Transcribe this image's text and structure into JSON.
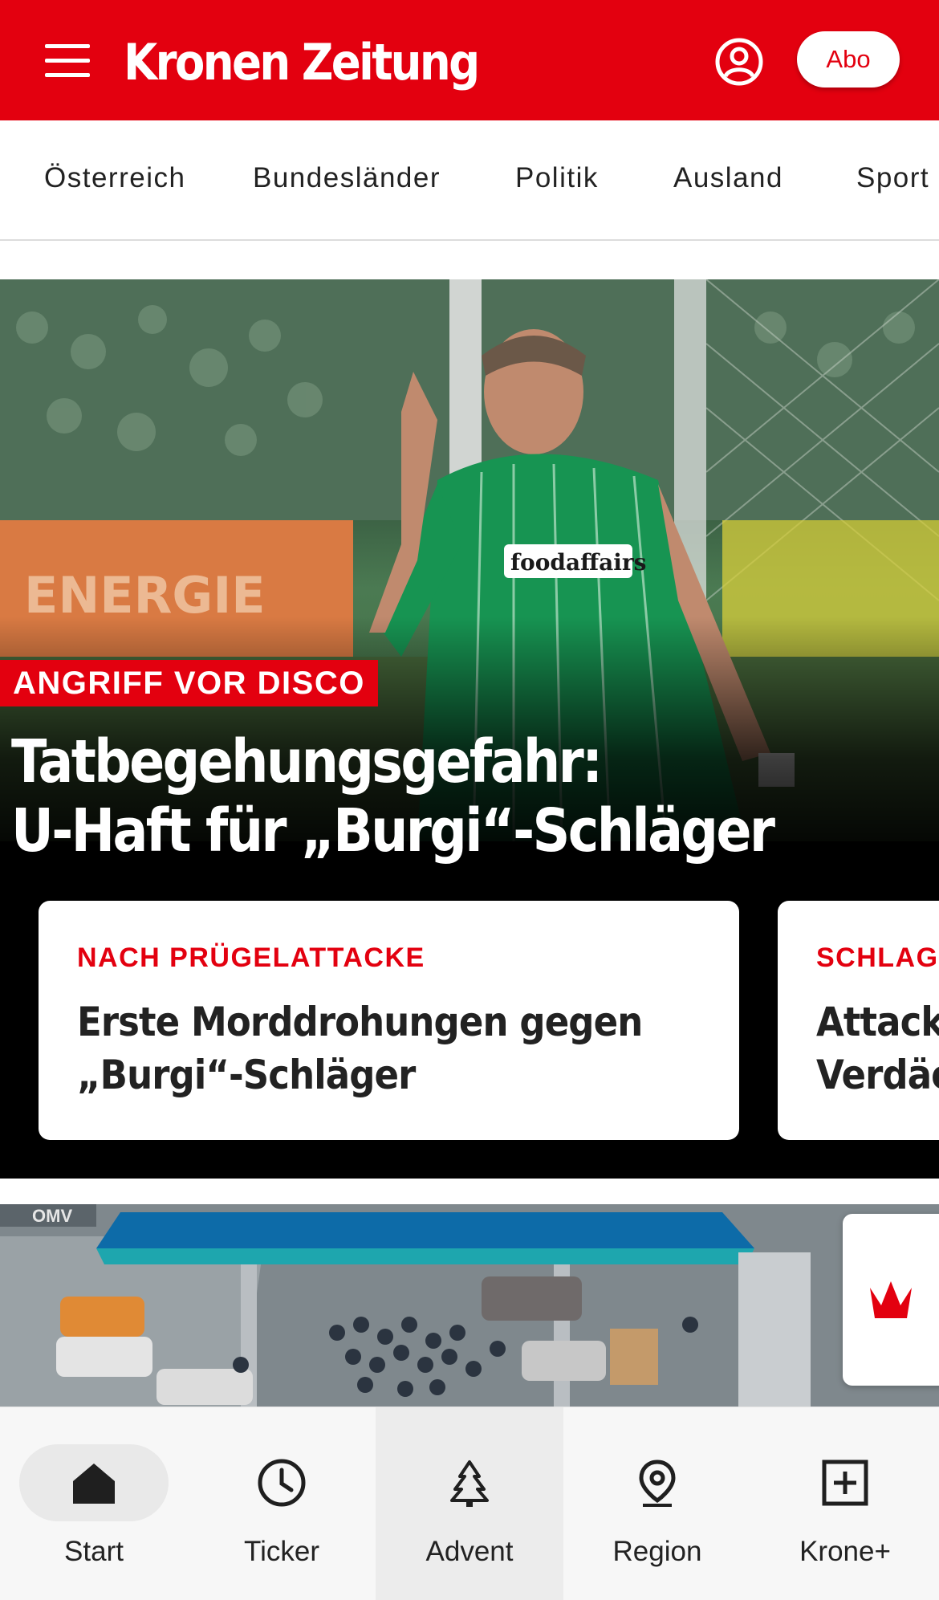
{
  "header": {
    "menu_icon": "hamburger-menu-icon",
    "logo": "Kronen Zeitung",
    "user_icon": "user-account-icon",
    "abo_label": "Abo",
    "brand_color": "#e3000f"
  },
  "nav": {
    "items": [
      "Österreich",
      "Bundesländer",
      "Politik",
      "Ausland",
      "Sport"
    ]
  },
  "hero": {
    "kicker": "ANGRIFF VOR DISCO",
    "title_line1": "Tatbegehungsgefahr:",
    "title_line2": "U-Haft für „Burgi“-Schläger",
    "teasers": [
      {
        "kicker": "NACH PRÜGELATTACKE",
        "title_line1": "Erste Morddrohungen gegen",
        "title_line2": "„Burgi“-Schläger"
      },
      {
        "kicker": "SCHLAG",
        "title_line1": "Attack",
        "title_line2": "Verdäc"
      }
    ]
  },
  "krone_plus_floating": {
    "icon": "krone-crown-icon"
  },
  "bottom_nav": {
    "items": [
      {
        "label": "Start",
        "icon": "home-icon"
      },
      {
        "label": "Ticker",
        "icon": "clock-icon"
      },
      {
        "label": "Advent",
        "icon": "christmas-tree-icon"
      },
      {
        "label": "Region",
        "icon": "location-pin-icon"
      },
      {
        "label": "Krone+",
        "icon": "plus-square-icon"
      }
    ]
  }
}
